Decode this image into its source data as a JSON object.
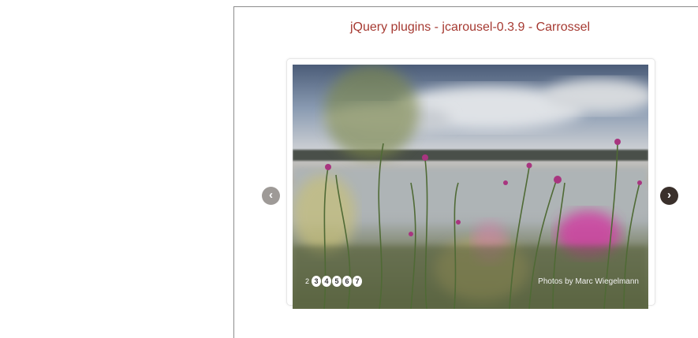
{
  "page": {
    "title": "jQuery plugins - jcarousel-0.3.9 - Carrossel"
  },
  "carousel": {
    "prev_label": "‹",
    "next_label": "›",
    "pagination": [
      "2",
      "3",
      "4",
      "5",
      "6",
      "7"
    ],
    "credit": "Photos by Marc Wiegelmann"
  },
  "colors": {
    "title": "#a63a32",
    "arrow_active": "#3a302b",
    "arrow_inactive": "#9e9a97"
  }
}
